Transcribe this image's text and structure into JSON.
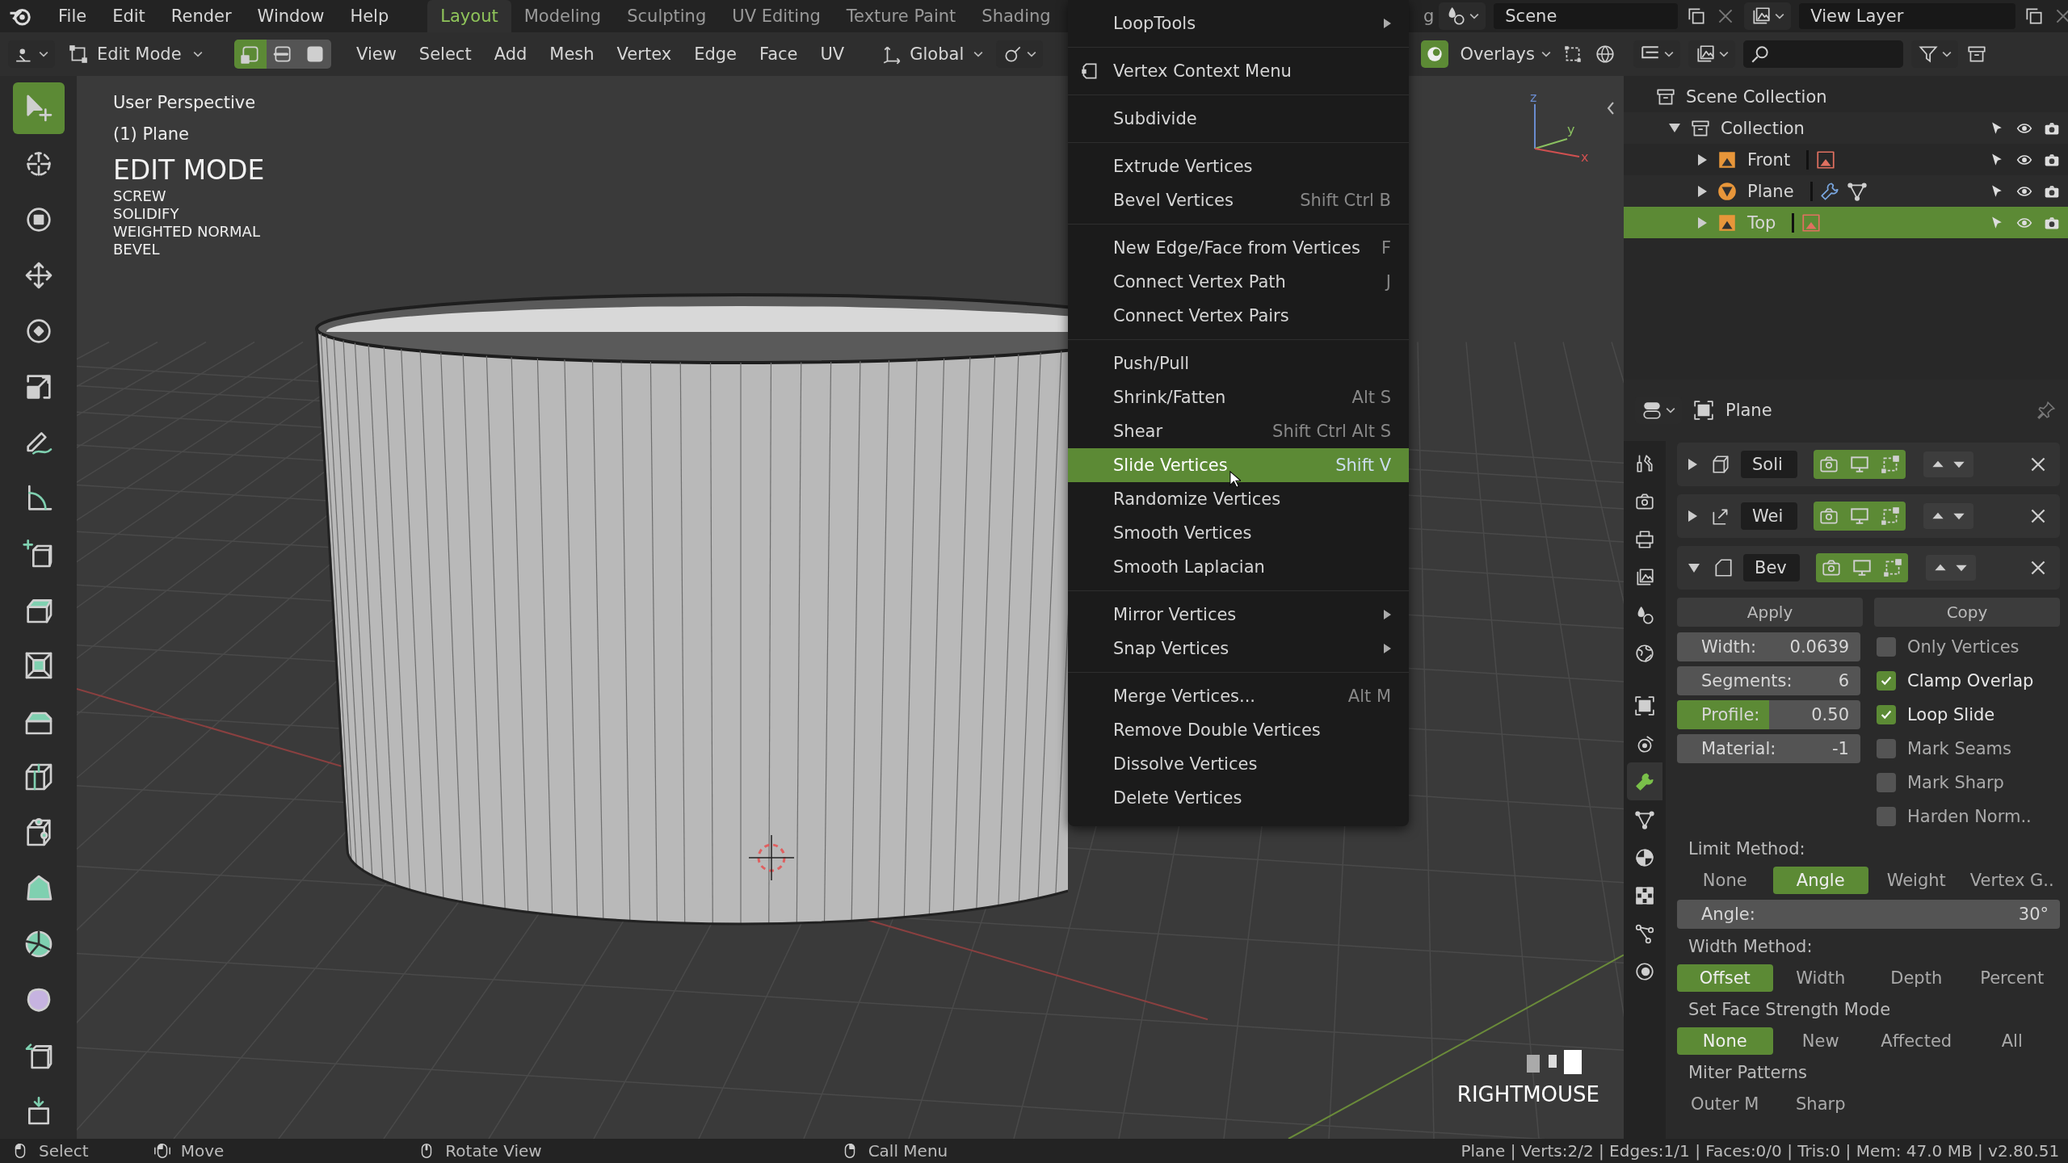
{
  "menubar": {
    "items": [
      "File",
      "Edit",
      "Render",
      "Window",
      "Help"
    ]
  },
  "workspace_tabs": [
    {
      "label": "Layout",
      "selected": true
    },
    {
      "label": "Modeling",
      "selected": false
    },
    {
      "label": "Sculpting",
      "selected": false
    },
    {
      "label": "UV Editing",
      "selected": false
    },
    {
      "label": "Texture Paint",
      "selected": false
    },
    {
      "label": "Shading",
      "selected": false
    },
    {
      "label": "g",
      "selected": false
    }
  ],
  "scene": {
    "name": "Scene"
  },
  "view_layer": {
    "name": "View Layer"
  },
  "viewport_header": {
    "mode": "Edit Mode",
    "select_modes": [
      {
        "kind": "vertex",
        "selected": true
      },
      {
        "kind": "edge",
        "selected": false
      },
      {
        "kind": "face",
        "selected": false
      }
    ],
    "menus": [
      "View",
      "Select",
      "Add",
      "Mesh",
      "Vertex",
      "Edge",
      "Face",
      "UV"
    ],
    "orientation": "Global",
    "overlays": "Overlays"
  },
  "toolbar": [
    {
      "kind": "select",
      "selected": true
    },
    {
      "kind": "cursor",
      "selected": false
    },
    {
      "kind": "transform",
      "selected": false
    },
    {
      "kind": "move",
      "selected": false
    },
    {
      "kind": "rotate",
      "selected": false
    },
    {
      "kind": "scale",
      "selected": false
    },
    {
      "kind": "annotate",
      "selected": false
    },
    {
      "kind": "measure",
      "selected": false
    },
    {
      "kind": "add_cube",
      "selected": false
    },
    {
      "kind": "extrude",
      "selected": false
    },
    {
      "kind": "inset",
      "selected": false
    },
    {
      "kind": "bevel",
      "selected": false
    },
    {
      "kind": "loop_cut",
      "selected": false
    },
    {
      "kind": "knife",
      "selected": false
    },
    {
      "kind": "poly_build",
      "selected": false
    },
    {
      "kind": "spin",
      "selected": false
    },
    {
      "kind": "smooth",
      "selected": false
    },
    {
      "kind": "edge_slide",
      "selected": false
    },
    {
      "kind": "shrink",
      "selected": false
    }
  ],
  "viewport": {
    "view_name": "User Perspective",
    "object": "(1) Plane",
    "mode_title": "EDIT MODE",
    "modifiers": [
      "SCREW",
      "SOLIDIFY",
      "WEIGHTED NORMAL",
      "BEVEL"
    ],
    "gizmo_axes": [
      "z",
      "y",
      "x"
    ],
    "key_hint": "RIGHTMOUSE"
  },
  "context_menu": {
    "addon_item": {
      "label": "LoopTools",
      "submenu": true
    },
    "title": "Vertex Context Menu",
    "groups": [
      [
        {
          "label": "Subdivide",
          "submenu": false,
          "selected": false
        }
      ],
      [
        {
          "label": "Extrude Vertices",
          "submenu": false,
          "selected": false
        },
        {
          "label": "Bevel Vertices",
          "shortcut": "Shift Ctrl B",
          "submenu": false,
          "selected": false
        }
      ],
      [
        {
          "label": "New Edge/Face from Vertices",
          "shortcut": "F",
          "submenu": false,
          "selected": false
        },
        {
          "label": "Connect Vertex Path",
          "shortcut": "J",
          "submenu": false,
          "selected": false
        },
        {
          "label": "Connect Vertex Pairs",
          "submenu": false,
          "selected": false
        }
      ],
      [
        {
          "label": "Push/Pull",
          "submenu": false,
          "selected": false
        },
        {
          "label": "Shrink/Fatten",
          "shortcut": "Alt S",
          "submenu": false,
          "selected": false
        },
        {
          "label": "Shear",
          "shortcut": "Shift Ctrl Alt S",
          "submenu": false,
          "selected": false
        },
        {
          "label": "Slide Vertices",
          "shortcut": "Shift V",
          "submenu": false,
          "selected": true
        },
        {
          "label": "Randomize Vertices",
          "submenu": false,
          "selected": false
        },
        {
          "label": "Smooth Vertices",
          "submenu": false,
          "selected": false
        },
        {
          "label": "Smooth Laplacian",
          "submenu": false,
          "selected": false
        }
      ],
      [
        {
          "label": "Mirror Vertices",
          "submenu": true,
          "selected": false
        },
        {
          "label": "Snap Vertices",
          "submenu": true,
          "selected": false
        }
      ],
      [
        {
          "label": "Merge Vertices...",
          "shortcut": "Alt M",
          "submenu": false,
          "selected": false
        },
        {
          "label": "Remove Double Vertices",
          "submenu": false,
          "selected": false
        },
        {
          "label": "Dissolve Vertices",
          "submenu": false,
          "selected": false
        },
        {
          "label": "Delete Vertices",
          "submenu": false,
          "selected": false
        }
      ]
    ]
  },
  "outliner": {
    "items": [
      {
        "label": "Scene Collection",
        "kind": "scene_collection",
        "children": [
          {
            "label": "Collection",
            "kind": "collection",
            "expanded": true,
            "selected": false,
            "children": [
              {
                "label": "Front",
                "kind": "image",
                "expanded": false,
                "selected": false
              },
              {
                "label": "Plane",
                "kind": "mesh",
                "expanded": false,
                "selected": false
              },
              {
                "label": "Top",
                "kind": "image",
                "expanded": false,
                "selected": true
              }
            ]
          }
        ]
      }
    ]
  },
  "properties": {
    "object": "Plane",
    "tabs": [
      {
        "kind": "tool",
        "selected": false
      },
      {
        "kind": "render",
        "selected": false
      },
      {
        "kind": "output",
        "selected": false
      },
      {
        "kind": "view_layer",
        "selected": false
      },
      {
        "kind": "scene",
        "selected": false
      },
      {
        "kind": "world",
        "selected": false
      },
      {
        "kind": "object",
        "selected": false
      },
      {
        "kind": "constraint",
        "selected": false
      },
      {
        "kind": "modifier",
        "selected": true
      },
      {
        "kind": "data",
        "selected": false
      },
      {
        "kind": "material",
        "selected": false
      },
      {
        "kind": "texture",
        "selected": false
      },
      {
        "kind": "particles",
        "selected": false
      },
      {
        "kind": "physics",
        "selected": false
      }
    ],
    "modifiers": [
      {
        "name": "Soli",
        "kind": "solidify",
        "expanded": false
      },
      {
        "name": "Wei",
        "kind": "weighted_normal",
        "expanded": false
      },
      {
        "name": "Bev",
        "kind": "bevel",
        "expanded": true
      }
    ],
    "buttons": [
      "Apply",
      "Copy"
    ],
    "fields": [
      {
        "label": "Width:",
        "value": "0.0639",
        "kind": "number"
      },
      {
        "label": "Segments:",
        "value": "6",
        "kind": "number"
      },
      {
        "label": "Profile:",
        "value": "0.50",
        "kind": "slider",
        "level": 0.5
      },
      {
        "label": "Material:",
        "value": "-1",
        "kind": "number"
      }
    ],
    "checkboxes": [
      {
        "label": "Only Vertices",
        "checked": false
      },
      {
        "label": "Clamp Overlap",
        "checked": true
      },
      {
        "label": "Loop Slide",
        "checked": true
      },
      {
        "label": "Mark Seams",
        "checked": false
      },
      {
        "label": "Mark Sharp",
        "checked": false
      },
      {
        "label": "Harden Norm..",
        "checked": false
      }
    ],
    "limit_method": {
      "label": "Limit Method:",
      "options": [
        {
          "label": "None",
          "selected": false
        },
        {
          "label": "Angle",
          "selected": true
        },
        {
          "label": "Weight",
          "selected": false
        },
        {
          "label": "Vertex G..",
          "selected": false
        }
      ]
    },
    "angle": {
      "label": "Angle:",
      "value": "30°"
    },
    "width_method": {
      "label": "Width Method:",
      "options": [
        {
          "label": "Offset",
          "selected": true
        },
        {
          "label": "Width",
          "selected": false
        },
        {
          "label": "Depth",
          "selected": false
        },
        {
          "label": "Percent",
          "selected": false
        }
      ]
    },
    "face_strength": {
      "label": "Set Face Strength Mode",
      "options": [
        {
          "label": "None",
          "selected": true
        },
        {
          "label": "New",
          "selected": false
        },
        {
          "label": "Affected",
          "selected": false
        },
        {
          "label": "All",
          "selected": false
        }
      ]
    },
    "miter": {
      "label": "Miter Patterns",
      "options": [
        "Outer M",
        "Sharp"
      ]
    }
  },
  "status_bar": {
    "hints": [
      {
        "kind": "mouse_left",
        "label": "Select"
      },
      {
        "kind": "mouse_drag",
        "label": "Move"
      },
      {
        "kind": "mouse_middle",
        "label": "Rotate View"
      },
      {
        "kind": "mouse_right",
        "label": "Call Menu"
      }
    ],
    "stats": "Plane | Verts:2/2 | Edges:1/1 | Faces:0/0 | Tris:0 | Mem: 47.0 MB | v2.80.51"
  }
}
